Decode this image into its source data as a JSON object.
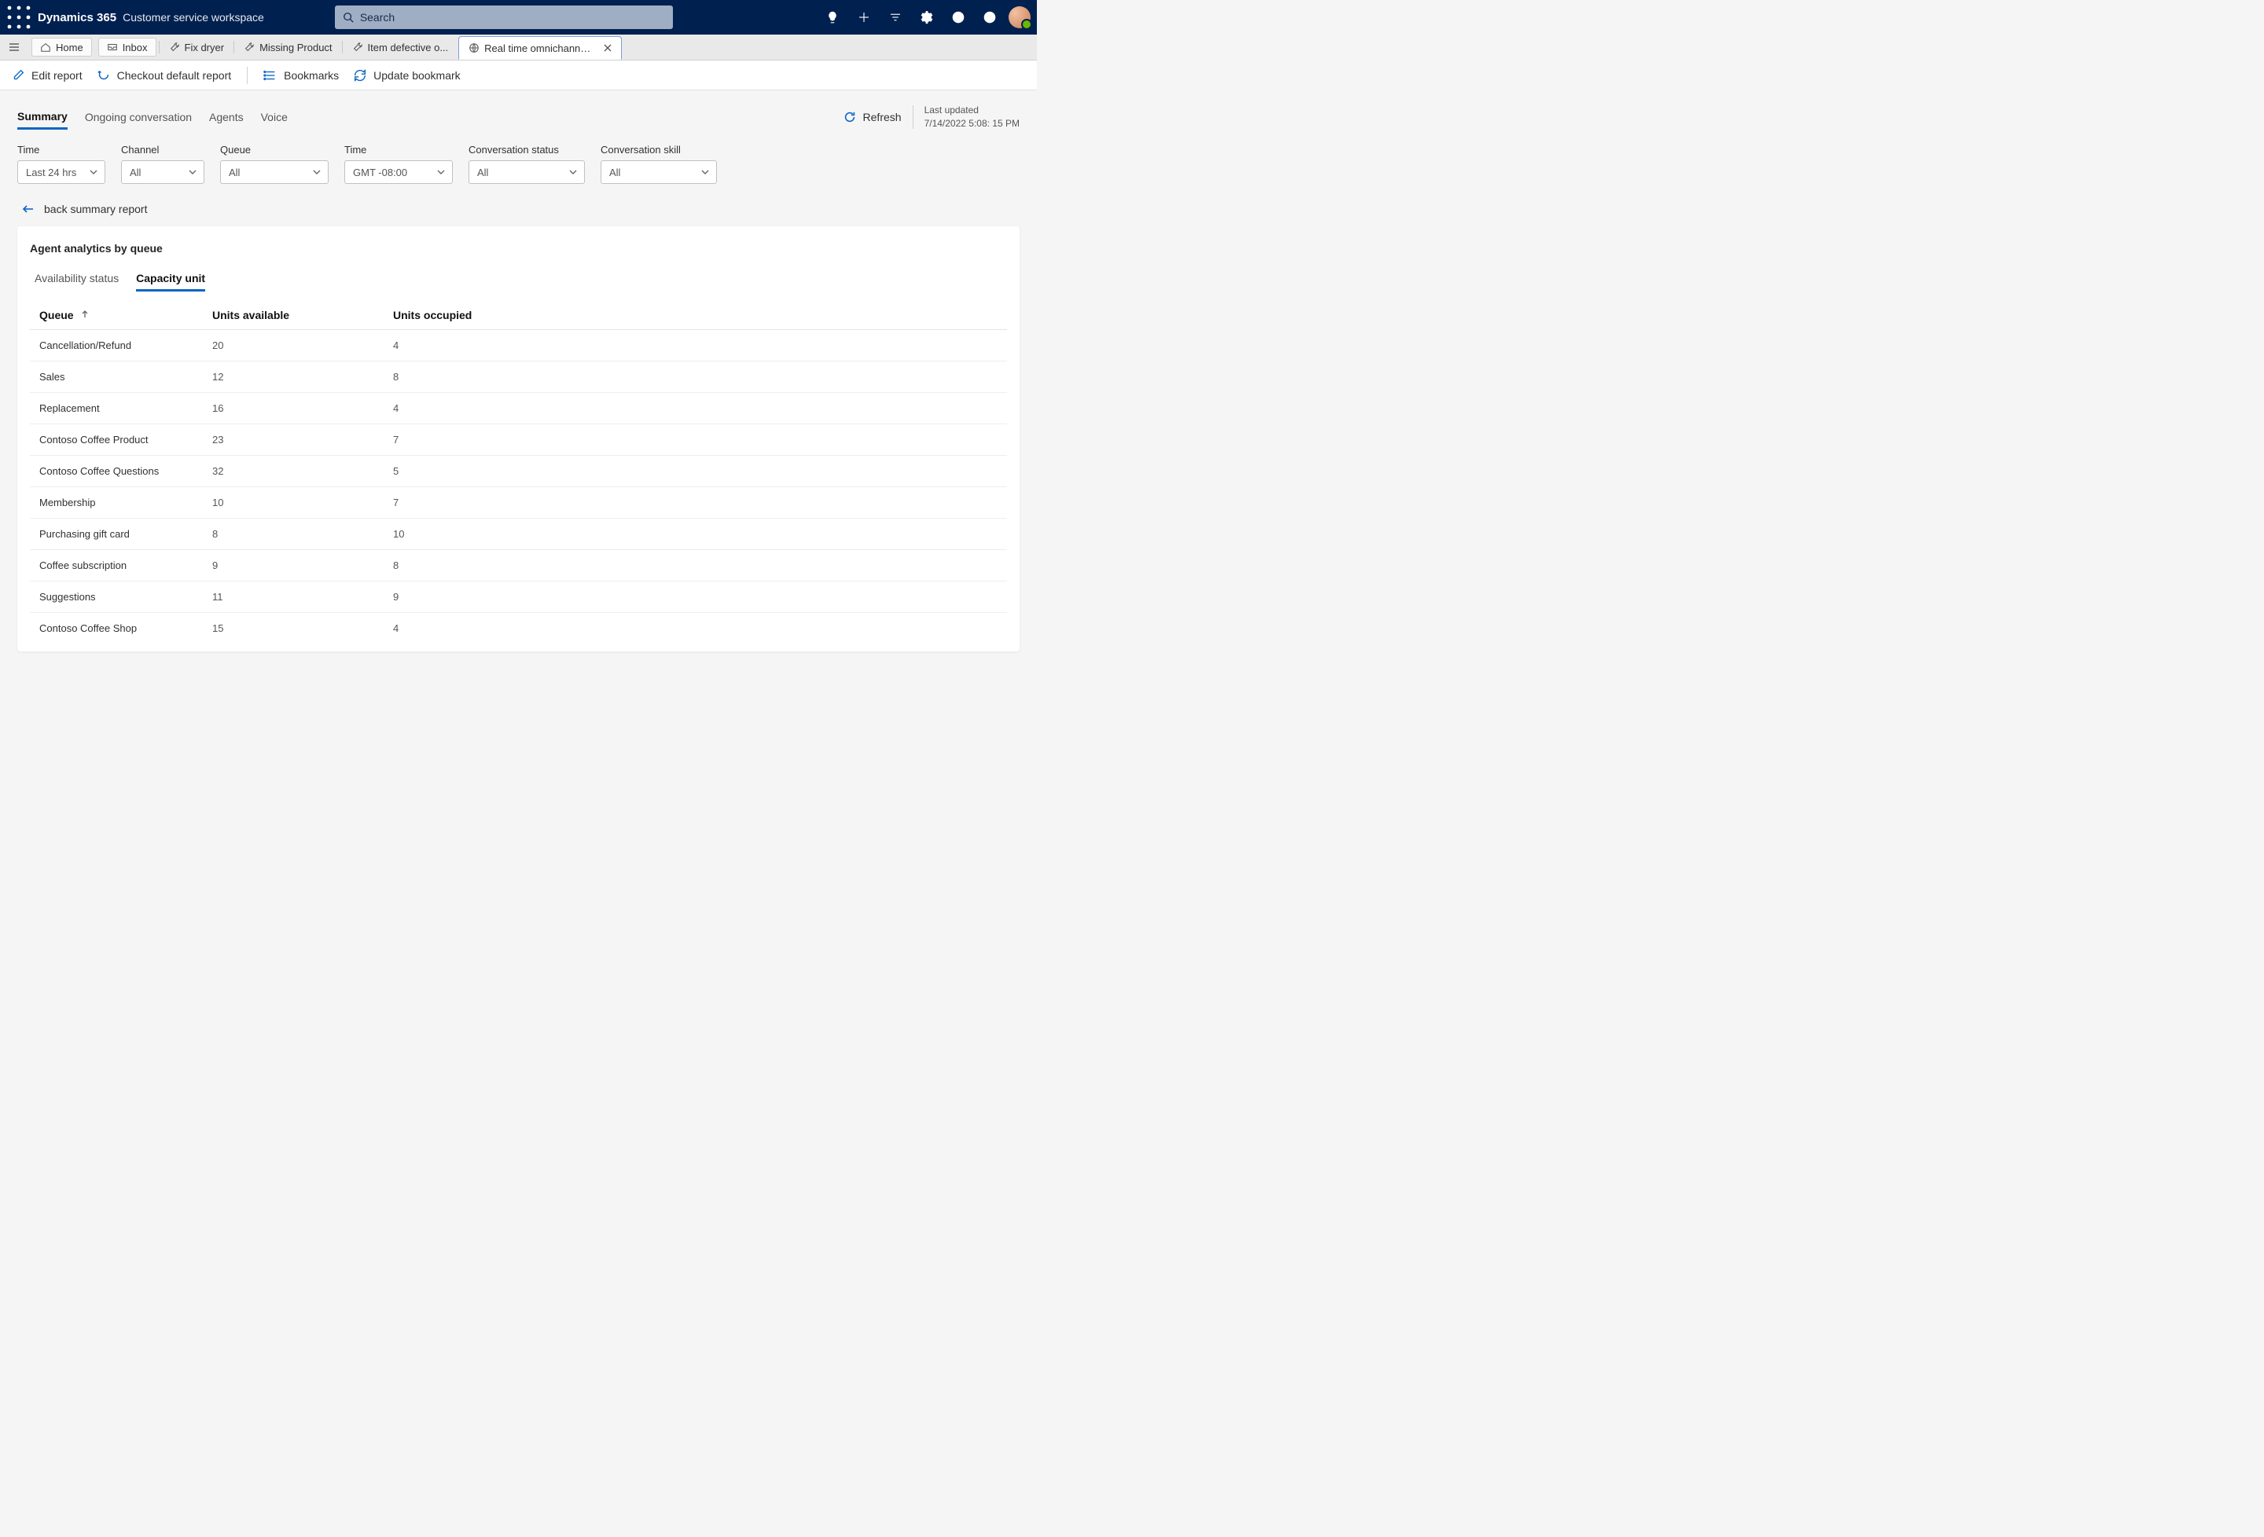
{
  "header": {
    "brand": "Dynamics 365",
    "workspace": "Customer service workspace",
    "search_placeholder": "Search"
  },
  "tabs": {
    "home": "Home",
    "inbox": "Inbox",
    "items": [
      {
        "label": "Fix dryer"
      },
      {
        "label": "Missing Product"
      },
      {
        "label": "Item defective o..."
      }
    ],
    "active": {
      "label": "Real time omnichannel an..."
    }
  },
  "commands": {
    "edit": "Edit report",
    "checkout": "Checkout default report",
    "bookmarks": "Bookmarks",
    "update_bookmark": "Update bookmark"
  },
  "view_tabs": [
    "Summary",
    "Ongoing conversation",
    "Agents",
    "Voice"
  ],
  "refresh": "Refresh",
  "last_updated_label": "Last updated",
  "last_updated_value": "7/14/2022 5:08: 15 PM",
  "filters": [
    {
      "label": "Time",
      "value": "Last 24 hrs",
      "w": "w110"
    },
    {
      "label": "Channel",
      "value": "All",
      "w": "w105"
    },
    {
      "label": "Queue",
      "value": "All",
      "w": "w135"
    },
    {
      "label": "Time",
      "value": "GMT -08:00",
      "w": "w135"
    },
    {
      "label": "Conversation status",
      "value": "All",
      "w": "w145"
    },
    {
      "label": "Conversation skill",
      "value": "All",
      "w": "w145"
    }
  ],
  "back_label": "back summary report",
  "panel_title": "Agent analytics by queue",
  "sub_tabs": [
    "Availability status",
    "Capacity unit"
  ],
  "table": {
    "columns": [
      "Queue",
      "Units available",
      "Units occupied"
    ],
    "rows": [
      {
        "queue": "Cancellation/Refund",
        "available": "20",
        "occupied": "4"
      },
      {
        "queue": "Sales",
        "available": "12",
        "occupied": "8"
      },
      {
        "queue": "Replacement",
        "available": "16",
        "occupied": "4"
      },
      {
        "queue": "Contoso Coffee Product",
        "available": "23",
        "occupied": "7"
      },
      {
        "queue": "Contoso Coffee Questions",
        "available": "32",
        "occupied": "5"
      },
      {
        "queue": "Membership",
        "available": "10",
        "occupied": "7"
      },
      {
        "queue": "Purchasing gift card",
        "available": "8",
        "occupied": "10"
      },
      {
        "queue": "Coffee subscription",
        "available": "9",
        "occupied": "8"
      },
      {
        "queue": "Suggestions",
        "available": "11",
        "occupied": "9"
      },
      {
        "queue": "Contoso Coffee Shop",
        "available": "15",
        "occupied": "4"
      }
    ]
  }
}
